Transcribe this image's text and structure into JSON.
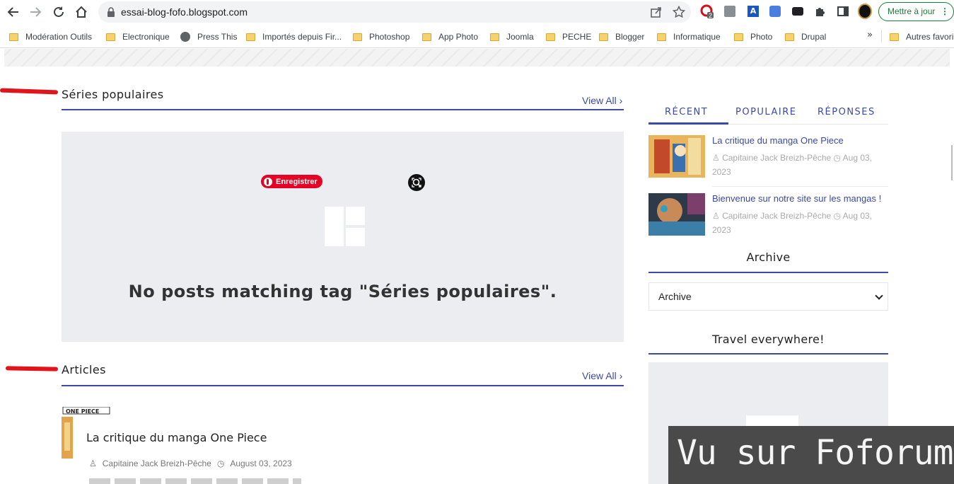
{
  "browser": {
    "url": "essai-blog-fofo.blogspot.com",
    "update_label": "Mettre à jour",
    "ext_badge": "2",
    "bookmarks": [
      "Modération Outils",
      "Electronique",
      "Press This",
      "Importés depuis Fir...",
      "Photoshop",
      "App Photo",
      "Joomla",
      "PECHE",
      "Blogger",
      "Informatique",
      "Photo",
      "Drupal"
    ],
    "other_bookmarks": "Autres favoris",
    "overflow": "»"
  },
  "main": {
    "popular": {
      "title": "Séries populaires",
      "view_all": "View All ›",
      "empty_message": "No posts matching tag \"Séries populaires\".",
      "pin_label": "Enregistrer"
    },
    "articles": {
      "title": "Articles",
      "view_all": "View All ›",
      "items": [
        {
          "title": "La critique du manga One Piece",
          "author": "Capitaine Jack Breizh-Pêche",
          "date": "August 03, 2023"
        }
      ]
    }
  },
  "sidebar": {
    "tabs": [
      "RÉCENT",
      "POPULAIRE",
      "RÉPONSES"
    ],
    "active_tab": "RÉCENT",
    "posts": [
      {
        "title": "La critique du manga One Piece",
        "author": "Capitaine Jack Breizh-Pêche",
        "date": "Aug 03, 2023"
      },
      {
        "title": "Bienvenue sur notre site sur les mangas !",
        "author": "Capitaine Jack Breizh-Pêche",
        "date": "Aug 03, 2023"
      }
    ],
    "archive_title": "Archive",
    "archive_select": "Archive",
    "travel_title": "Travel everywhere!"
  },
  "watermark": "Vu sur Foforum",
  "colors": {
    "accent": "#3a4aa8",
    "annotation": "#e0141a",
    "pinterest": "#e60023",
    "update": "#188038"
  }
}
